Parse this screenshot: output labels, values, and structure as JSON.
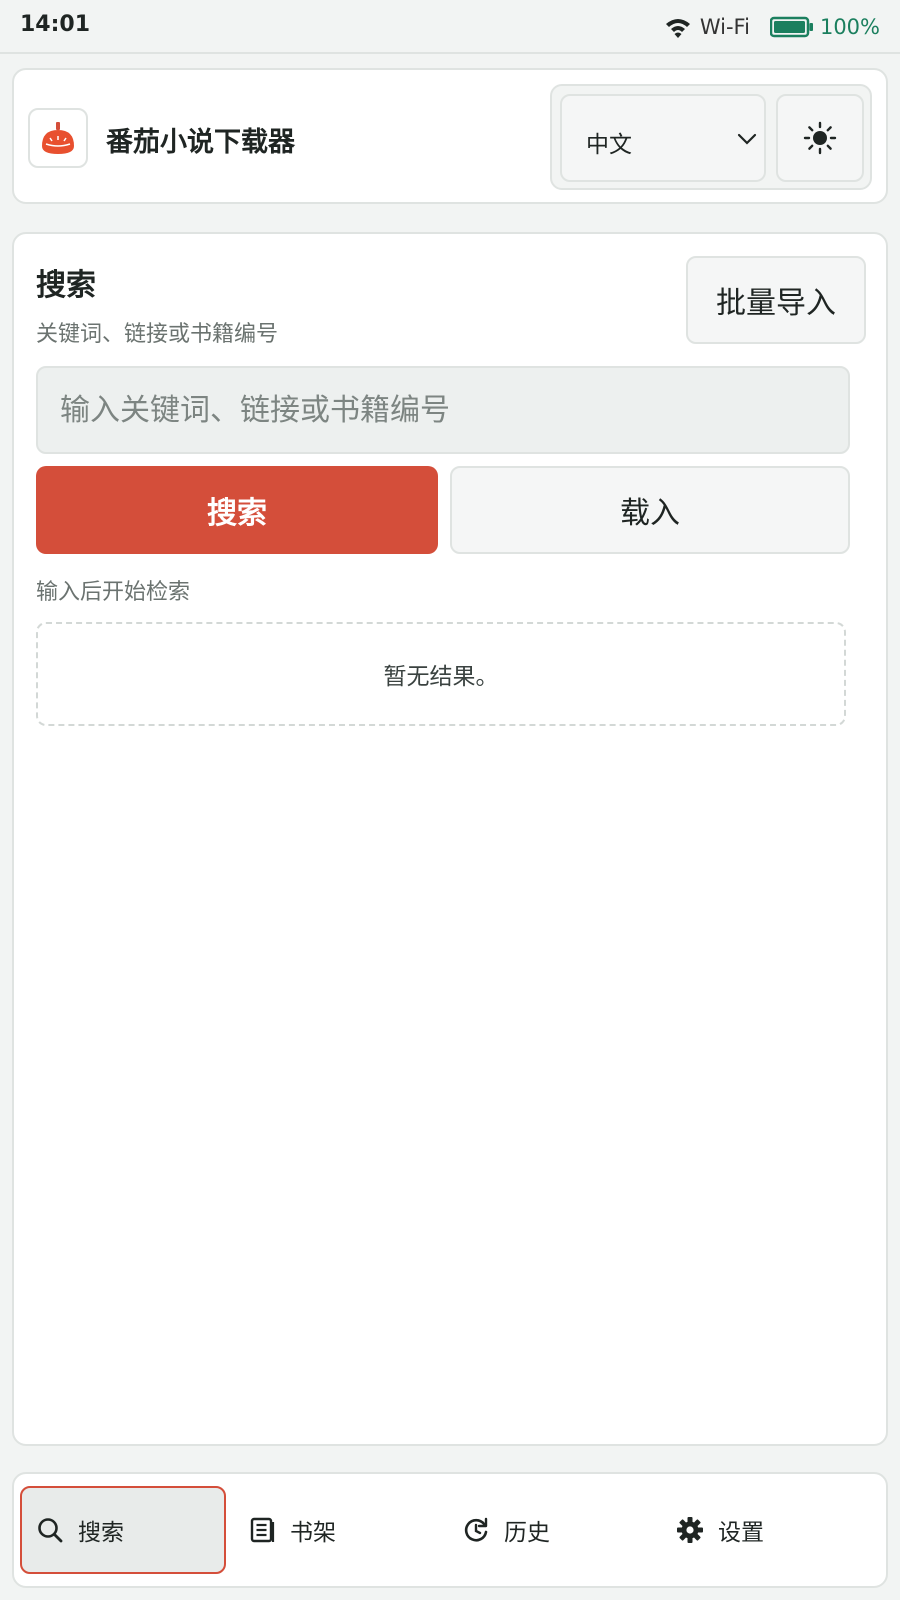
{
  "status_bar": {
    "time": "14:01",
    "wifi_label": "Wi-Fi",
    "battery": "100%",
    "battery_level": 1.0,
    "battery_color": "#1b7f5e"
  },
  "header": {
    "app_title": "番茄小说下载器",
    "app_icon": "tomato-icon",
    "language": "中文",
    "theme_icon": "sun-icon"
  },
  "search": {
    "title": "搜索",
    "subtitle": "关键词、链接或书籍编号",
    "batch_import_label": "批量导入",
    "input_placeholder": "输入关键词、链接或书籍编号",
    "input_value": "",
    "search_button_label": "搜索",
    "load_button_label": "载入",
    "hint": "输入后开始检索",
    "empty_result": "暂无结果。"
  },
  "nav": {
    "items": [
      {
        "label": "搜索",
        "icon": "search-icon",
        "active": true
      },
      {
        "label": "书架",
        "icon": "bookshelf-icon",
        "active": false
      },
      {
        "label": "历史",
        "icon": "history-icon",
        "active": false
      },
      {
        "label": "设置",
        "icon": "gear-icon",
        "active": false
      }
    ]
  },
  "colors": {
    "accent": "#d44e3a",
    "background": "#f2f4f3",
    "card": "#ffffff"
  }
}
